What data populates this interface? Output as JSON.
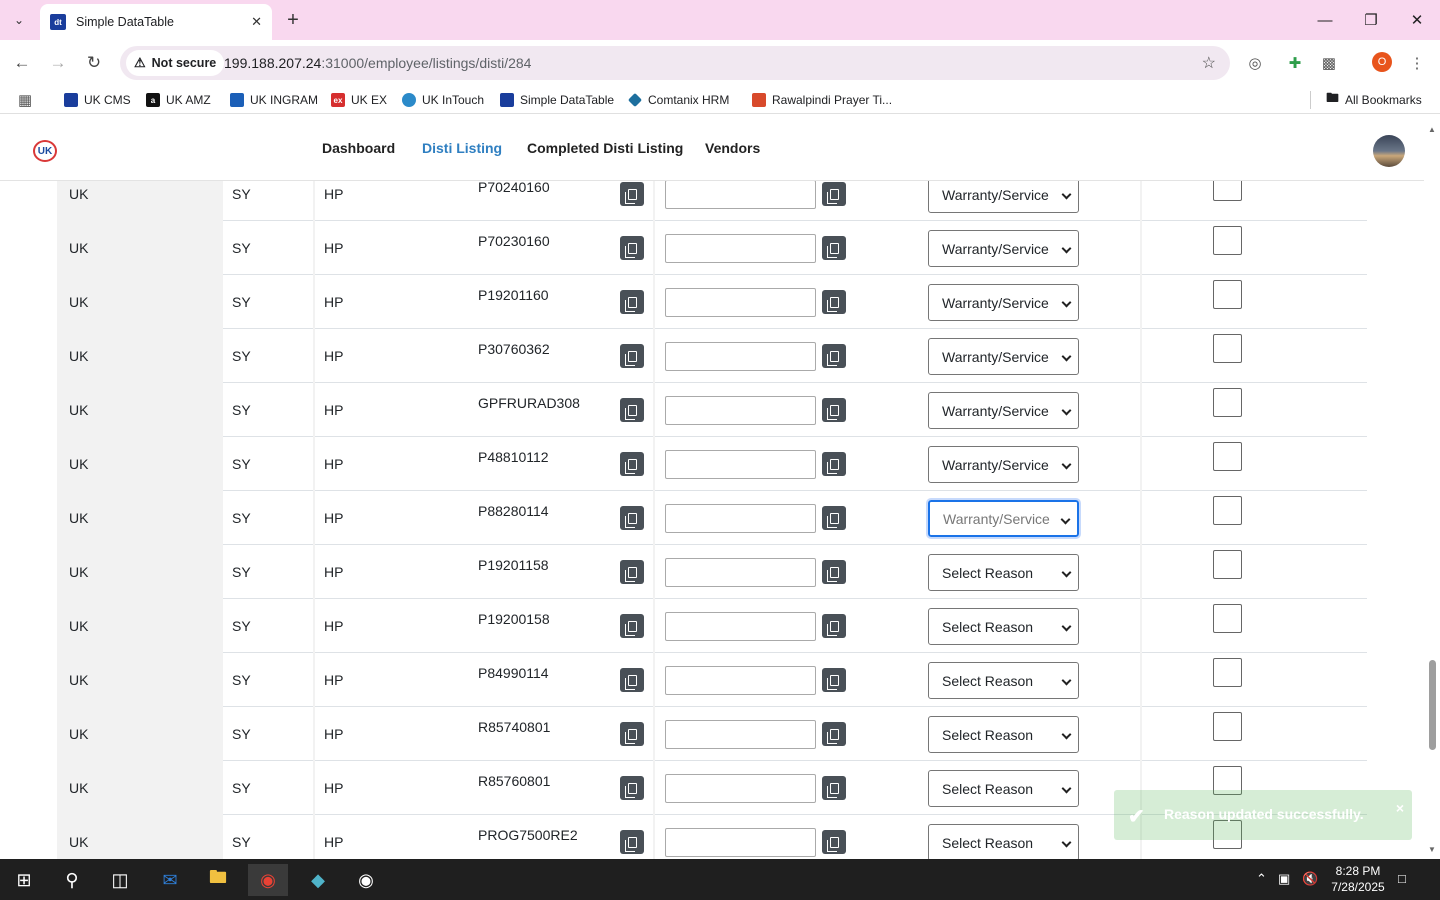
{
  "browser": {
    "tab_title": "Simple DataTable",
    "security_label": "Not secure",
    "url_host": "199.188.207.24",
    "url_path": ":31000/employee/listings/disti/284",
    "profile_initial": "O",
    "favicon_text": "dt",
    "bookmarks": [
      {
        "label": "UK CMS",
        "color": "#1a3d9c"
      },
      {
        "label": "UK AMZ",
        "color": "#111111"
      },
      {
        "label": "UK INGRAM",
        "color": "#1b5fb7"
      },
      {
        "label": "UK EX",
        "color": "#d62f2f"
      },
      {
        "label": "UK InTouch",
        "color": "#2b8ac9"
      },
      {
        "label": "Simple DataTable",
        "color": "#1a3d9c"
      },
      {
        "label": "Comtanix HRM",
        "color": "#1d6f9e"
      },
      {
        "label": "Rawalpindi Prayer Ti...",
        "color": "#d84a2b"
      }
    ],
    "all_bookmarks": "All Bookmarks"
  },
  "app": {
    "logo_text": "UK",
    "nav": [
      "Dashboard",
      "Disti Listing",
      "Completed Disti Listing",
      "Vendors"
    ],
    "active_nav": "Disti Listing"
  },
  "rows": [
    {
      "c0": "UK",
      "c1": "SY",
      "c2": "HP",
      "code": "P70240160",
      "reason": "Warranty/Service"
    },
    {
      "c0": "UK",
      "c1": "SY",
      "c2": "HP",
      "code": "P70230160",
      "reason": "Warranty/Service"
    },
    {
      "c0": "UK",
      "c1": "SY",
      "c2": "HP",
      "code": "P19201160",
      "reason": "Warranty/Service"
    },
    {
      "c0": "UK",
      "c1": "SY",
      "c2": "HP",
      "code": "P30760362",
      "reason": "Warranty/Service"
    },
    {
      "c0": "UK",
      "c1": "SY",
      "c2": "HP",
      "code": "GPFRURAD308",
      "reason": "Warranty/Service"
    },
    {
      "c0": "UK",
      "c1": "SY",
      "c2": "HP",
      "code": "P48810112",
      "reason": "Warranty/Service"
    },
    {
      "c0": "UK",
      "c1": "SY",
      "c2": "HP",
      "code": "P88280114",
      "reason": "Warranty/Service",
      "focused": true
    },
    {
      "c0": "UK",
      "c1": "SY",
      "c2": "HP",
      "code": "P19201158",
      "reason": "Select Reason"
    },
    {
      "c0": "UK",
      "c1": "SY",
      "c2": "HP",
      "code": "P19200158",
      "reason": "Select Reason"
    },
    {
      "c0": "UK",
      "c1": "SY",
      "c2": "HP",
      "code": "P84990114",
      "reason": "Select Reason"
    },
    {
      "c0": "UK",
      "c1": "SY",
      "c2": "HP",
      "code": "R85740801",
      "reason": "Select Reason"
    },
    {
      "c0": "UK",
      "c1": "SY",
      "c2": "HP",
      "code": "R85760801",
      "reason": "Select Reason"
    },
    {
      "c0": "UK",
      "c1": "SY",
      "c2": "HP",
      "code": "PROG7500RE2",
      "reason": "Select Reason"
    }
  ],
  "toast": {
    "message": "Reason updated successfully.",
    "close": "×"
  },
  "taskbar": {
    "time": "8:28 PM",
    "date": "7/28/2025"
  }
}
